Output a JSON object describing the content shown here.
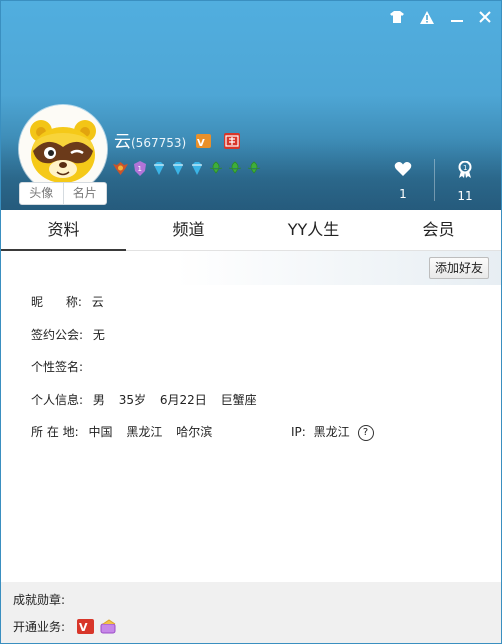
{
  "header": {
    "nickname": "云",
    "user_id": "(567753)",
    "avatar_button": "头像",
    "card_button": "名片",
    "likes_count": "1",
    "achievements_count": "11",
    "accent_color": "#4ea6d5"
  },
  "window_controls": {
    "icons": [
      "shirt-icon",
      "alert-icon",
      "minimize-icon",
      "close-icon"
    ]
  },
  "tabs": [
    {
      "label": "资料",
      "active": true
    },
    {
      "label": "频道",
      "active": false
    },
    {
      "label": "YY人生",
      "active": false
    },
    {
      "label": "会员",
      "active": false
    }
  ],
  "toolbar": {
    "add_friend_label": "添加好友"
  },
  "profile": {
    "nickname_label": "昵      称:",
    "nickname_value": "云",
    "guild_label": "签约公会:",
    "guild_value": "无",
    "signature_label": "个性签名:",
    "personal_label": "个人信息:",
    "gender": "男",
    "age": "35岁",
    "birthday": "6月22日",
    "zodiac": "巨蟹座",
    "location_label": "所 在 地:",
    "country": "中国",
    "province": "黑龙江",
    "city": "哈尔滨",
    "ip_label": "IP:",
    "ip_value": "黑龙江"
  },
  "footer": {
    "medals_label": "成就勋章:",
    "services_label": "开通业务:"
  }
}
